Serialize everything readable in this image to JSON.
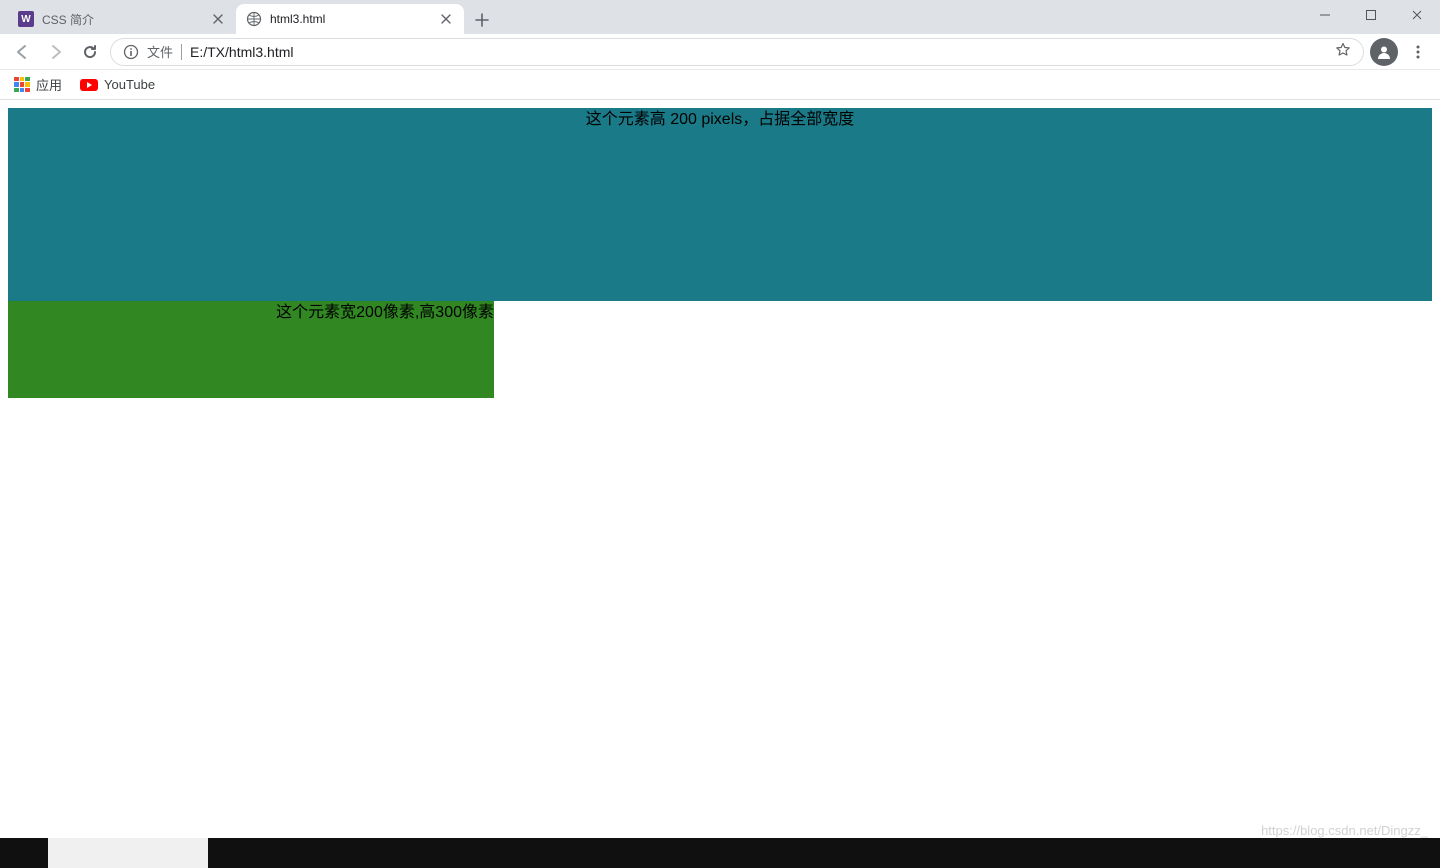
{
  "window": {
    "minimize": "—",
    "maximize": "▢",
    "close": "✕"
  },
  "tabs": [
    {
      "favicon_letter": "W",
      "title": "CSS 简介",
      "active": false
    },
    {
      "favicon_letter": "",
      "title": "html3.html",
      "active": true
    }
  ],
  "toolbar": {
    "file_label": "文件",
    "url": "E:/TX/html3.html"
  },
  "bookmarks": {
    "apps_label": "应用",
    "youtube_label": "YouTube"
  },
  "page": {
    "box1_text": "这个元素高 200 pixels，占据全部宽度",
    "box2_text": "这个元素宽200像素,高300像素",
    "box1_bg": "#1a7a87",
    "box2_bg": "#318823"
  },
  "watermark": "https://blog.csdn.net/Dingzz_"
}
